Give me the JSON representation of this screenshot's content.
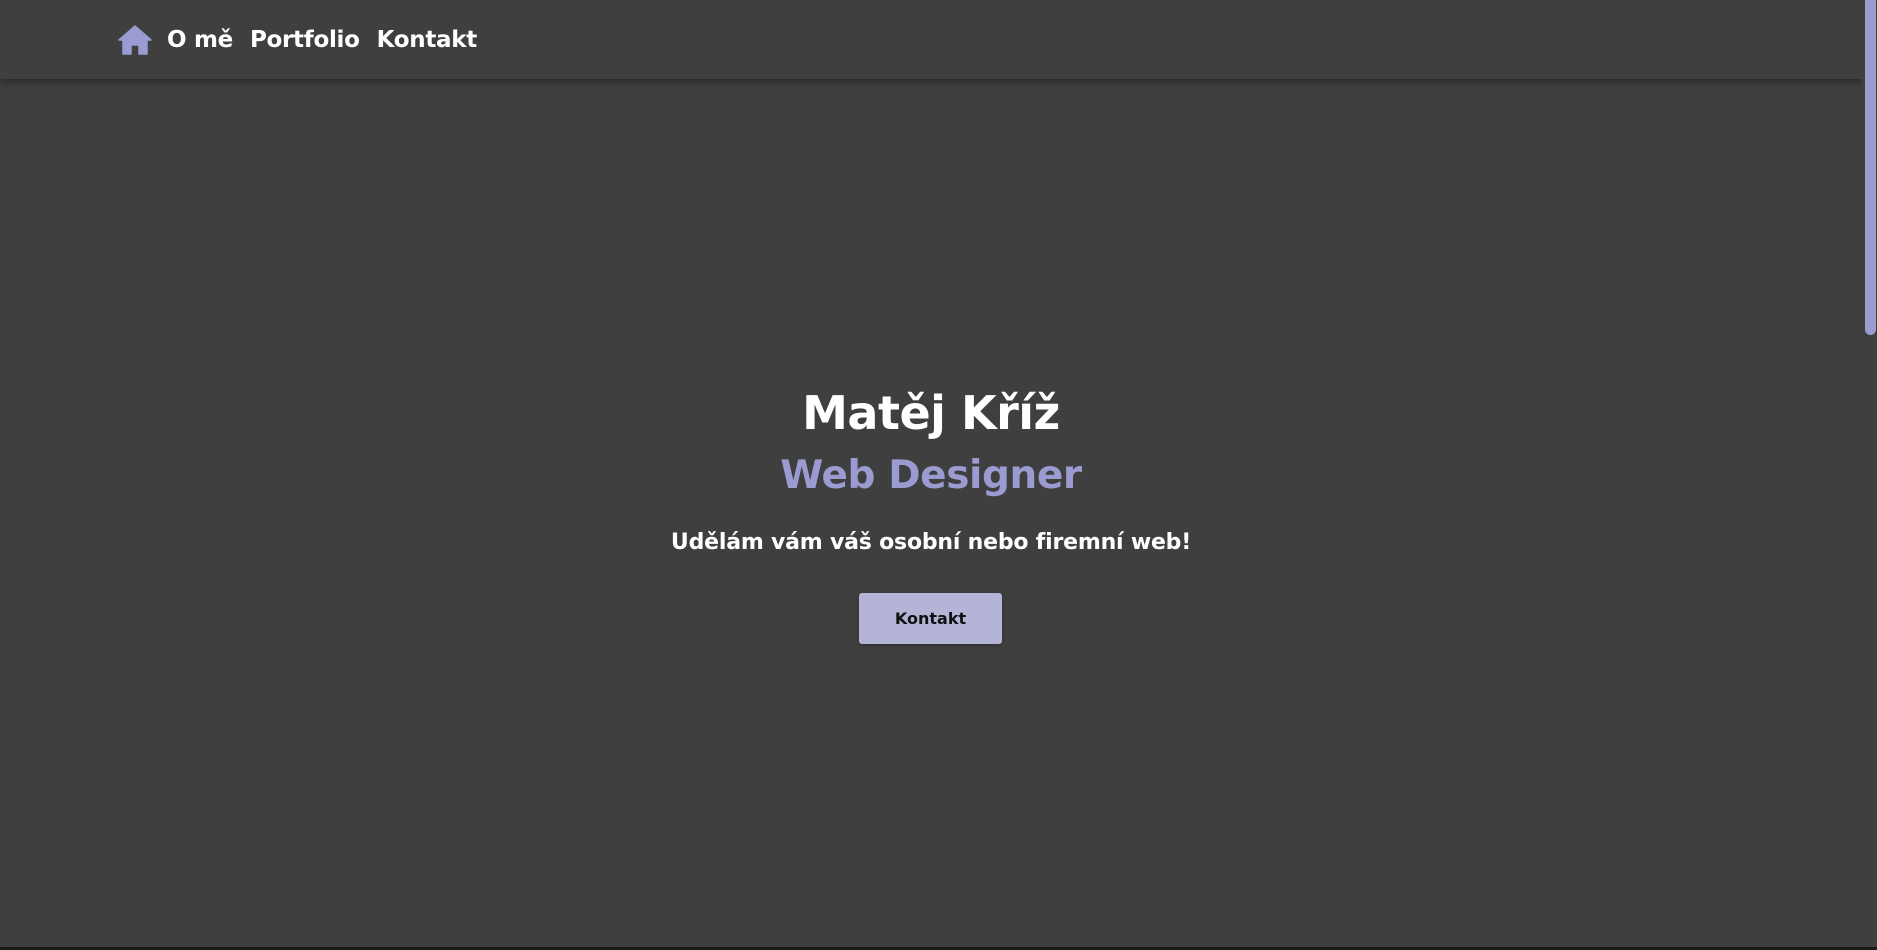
{
  "nav": {
    "home_icon": "home-icon",
    "items": [
      {
        "label": "O mě"
      },
      {
        "label": "Portfolio"
      },
      {
        "label": "Kontakt"
      }
    ]
  },
  "hero": {
    "name": "Matěj Kříž",
    "role": "Web Designer",
    "tagline": "Udělám vám váš osobní nebo firemní web!",
    "cta_label": "Kontakt"
  },
  "colors": {
    "background": "#3f3f3f",
    "accent": "#9a9cd1",
    "button": "#b3b4d6",
    "text": "#ffffff"
  }
}
